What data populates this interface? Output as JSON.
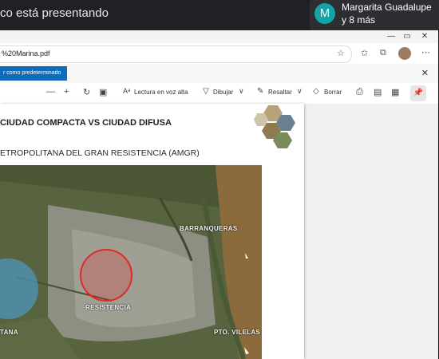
{
  "meeting": {
    "presenting_text": "co está presentando",
    "participant_initial": "M",
    "participant_name": "Margarita Guadalupe",
    "more_participants": "y 8 más",
    "avatar_color": "#12a4a6"
  },
  "browser": {
    "url": "%20Marina.pdf",
    "window_controls": [
      "—",
      "▭",
      "✕"
    ],
    "infobar_button": "r como predeterminado",
    "infobar_close": "✕"
  },
  "pdf_toolbar": {
    "zoom_out": "—",
    "zoom_in": "+",
    "read_aloud": "Lectura en voz alta",
    "draw": "Dibujar",
    "highlight": "Resaltar",
    "erase": "Borrar"
  },
  "document": {
    "title": "CIUDAD COMPACTA VS CIUDAD DIFUSA",
    "subtitle": "ETROPOLITANA DEL GRAN RESISTENCIA (AMGR)",
    "map_labels": {
      "barranqueras": "BARRANQUERAS",
      "resistencia": "RESISTENCIA",
      "left_city": "TANA",
      "pto_vilelas": "PTO. VILELAS"
    }
  },
  "colors": {
    "accent_button": "#0f6cbd",
    "red_circle": "#e02a2a",
    "blue_circle": "#4aa3d8"
  }
}
